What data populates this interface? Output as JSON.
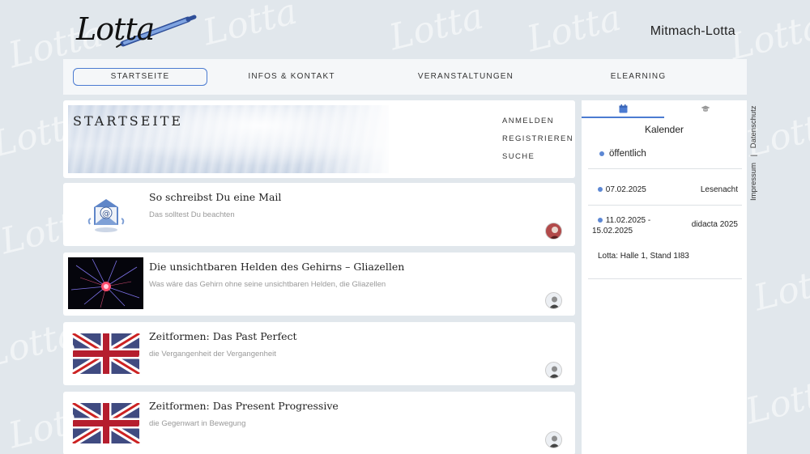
{
  "header": {
    "site_title": "Mitmach-Lotta",
    "logo_text": "Lotta"
  },
  "nav": {
    "items": [
      {
        "label": "STARTSEITE",
        "active": true
      },
      {
        "label": "INFOS & KONTAKT",
        "active": false
      },
      {
        "label": "VERANSTALTUNGEN",
        "active": false
      },
      {
        "label": "ELEARNING",
        "active": false
      }
    ]
  },
  "hero": {
    "title": "STARTSEITE",
    "links": [
      "ANMELDEN",
      "REGISTRIEREN",
      "SUCHE"
    ]
  },
  "articles": [
    {
      "title": "So schreibst Du eine Mail",
      "subtitle": "Das solltest Du beachten",
      "image": "email-icon"
    },
    {
      "title": "Die unsichtbaren Helden des Gehirns – Gliazellen",
      "subtitle": "Was wäre das Gehirn ohne seine unsichtbaren Helden, die Gliazellen",
      "image": "neuron-image"
    },
    {
      "title": "Zeitformen: Das Past Perfect",
      "subtitle": "die Vergangenheit der Vergangenheit",
      "image": "union-jack-image"
    },
    {
      "title": "Zeitformen: Das Present Progressive",
      "subtitle": "die Gegenwart in Bewegung",
      "image": "union-jack-image"
    }
  ],
  "sidebar": {
    "tabs": [
      {
        "icon": "calendar-icon",
        "active": true
      },
      {
        "icon": "graduation-cap-icon",
        "active": false
      }
    ],
    "heading": "Kalender",
    "legend_label": "öffentlich",
    "events": [
      {
        "date": "07.02.2025",
        "title": "Lesenacht"
      },
      {
        "date_line1": "11.02.2025 -",
        "date_line2": "15.02.2025",
        "title": "didacta 2025",
        "detail": "Lotta: Halle 1, Stand 1I83"
      }
    ]
  },
  "footer_links": {
    "impressum": "Impressum",
    "separator": "|",
    "datenschutz": "Datenschutz"
  },
  "colors": {
    "accent": "#4b7bd1",
    "event_dot": "#5d88d4",
    "background": "#e1e7ec"
  }
}
